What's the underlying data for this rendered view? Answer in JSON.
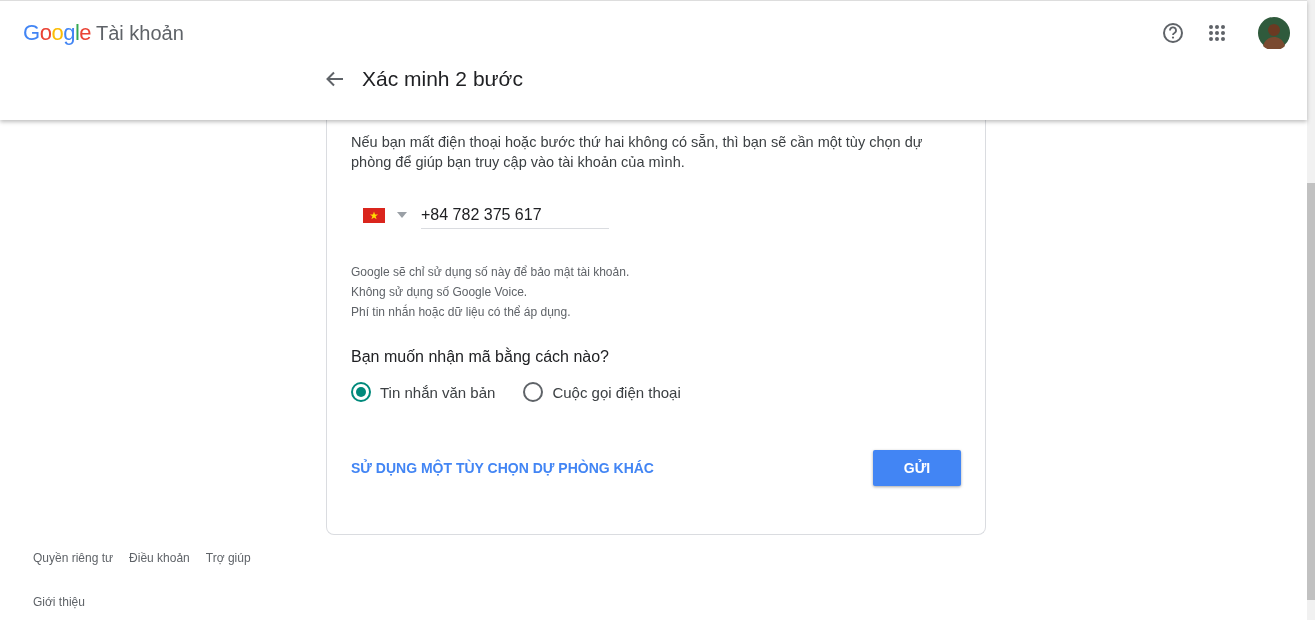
{
  "header": {
    "logo": "Google",
    "product": "Tài khoản",
    "title": "Xác minh 2 bước"
  },
  "card": {
    "intro": "Nếu bạn mất điện thoại hoặc bước thứ hai không có sẵn, thì bạn sẽ cần một tùy chọn dự phòng để giúp bạn truy cập vào tài khoản của mình.",
    "phone": {
      "value": "+84 782 375 617"
    },
    "notes": [
      "Google sẽ chỉ sử dụng số này để bảo mật tài khoản.",
      "Không sử dụng số Google Voice.",
      "Phí tin nhắn hoặc dữ liệu có thể áp dụng."
    ],
    "question": "Bạn muốn nhận mã bằng cách nào?",
    "options": [
      {
        "label": "Tin nhắn văn bản",
        "selected": true
      },
      {
        "label": "Cuộc gọi điện thoại",
        "selected": false
      }
    ],
    "link": "SỬ DỤNG MỘT TÙY CHỌN DỰ PHÒNG KHÁC",
    "button": "GỬI"
  },
  "footer": {
    "links": [
      "Quyền riêng tư",
      "Điều khoản",
      "Trợ giúp"
    ],
    "about": "Giới thiệu"
  }
}
